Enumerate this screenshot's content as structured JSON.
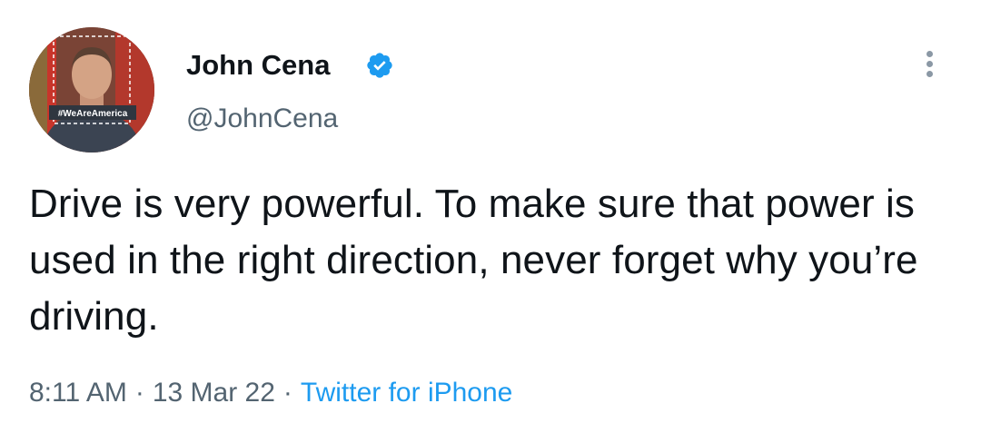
{
  "author": {
    "display_name": "John Cena",
    "handle": "@JohnCena",
    "verified": true,
    "verified_icon": "verified-badge-icon",
    "avatar_caption": "#WeAreAmerica"
  },
  "tweet": {
    "text": "Drive is very powerful. To make sure that power is used in the right direction, never forget why you’re driving.",
    "time": "8:11 AM",
    "separator": "·",
    "date": "13 Mar 22",
    "source": "Twitter for iPhone"
  },
  "menu": {
    "icon": "more-options-icon"
  },
  "colors": {
    "text": "#0f1419",
    "secondary": "#536471",
    "accent": "#1d9bf0",
    "background": "#ffffff"
  }
}
